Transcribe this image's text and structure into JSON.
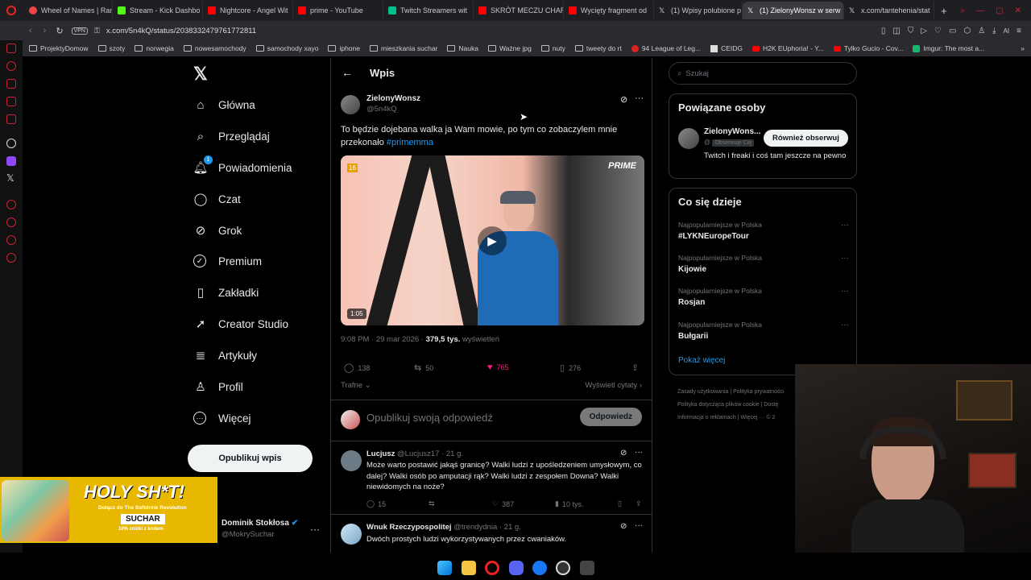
{
  "browser": {
    "tabs": [
      {
        "label": "Wheel of Names | Ran",
        "color": "#e44"
      },
      {
        "label": "Stream - Kick Dashbo",
        "color": "#53fc18"
      },
      {
        "label": "Nightcore - Angel Wit",
        "color": "#ff0000"
      },
      {
        "label": "prime - YouTube",
        "color": "#ff0000"
      },
      {
        "label": "Twitch Streamers wit",
        "color": "#00c08b"
      },
      {
        "label": "SKRÓT MECZU CHAR",
        "color": "#ff0000"
      },
      {
        "label": "Wycięty fragment od",
        "color": "#ff0000"
      },
      {
        "label": "(1) Wpisy polubione p",
        "color": "#dddddd"
      },
      {
        "label": "(1) ZielonyWonsz w serw",
        "color": "#dddddd",
        "active": true
      },
      {
        "label": "x.com/tantehenia/stat",
        "color": "#dddddd"
      }
    ],
    "vpn_label": "VPN",
    "url": "x.com/5n4kQ/status/2038332479761772811",
    "ai_label": "AI",
    "bookmarks": [
      {
        "label": "ProjektyDomow",
        "type": "folder"
      },
      {
        "label": "szoty",
        "type": "folder"
      },
      {
        "label": "norwegia",
        "type": "folder"
      },
      {
        "label": "nowesamochody",
        "type": "folder"
      },
      {
        "label": "samochody xayo",
        "type": "folder"
      },
      {
        "label": "iphone",
        "type": "folder"
      },
      {
        "label": "mieszkania suchar",
        "type": "folder"
      },
      {
        "label": "Nauka",
        "type": "folder"
      },
      {
        "label": "Ważne jpg",
        "type": "folder"
      },
      {
        "label": "nuty",
        "type": "folder"
      },
      {
        "label": "tweety do rt",
        "type": "folder"
      },
      {
        "label": "94 League of Leg...",
        "type": "site"
      },
      {
        "label": "CEIDG",
        "type": "site"
      },
      {
        "label": "H2K EUphoria! - Y...",
        "type": "site"
      },
      {
        "label": "Tylko Gucio - Cov...",
        "type": "site"
      },
      {
        "label": "Imgur: The most a...",
        "type": "site"
      }
    ]
  },
  "nav": {
    "items": [
      {
        "label": "Główna",
        "icon": "home-icon",
        "glyph": "⌂"
      },
      {
        "label": "Przeglądaj",
        "icon": "search-icon",
        "glyph": "⌕"
      },
      {
        "label": "Powiadomienia",
        "icon": "bell-icon",
        "glyph": "♫",
        "badge": "1"
      },
      {
        "label": "Czat",
        "icon": "chat-icon",
        "glyph": "◯"
      },
      {
        "label": "Grok",
        "icon": "grok-icon",
        "glyph": "⊘"
      },
      {
        "label": "Premium",
        "icon": "verified-icon",
        "glyph": "✓"
      },
      {
        "label": "Zakładki",
        "icon": "bookmark-icon",
        "glyph": "▯"
      },
      {
        "label": "Creator Studio",
        "icon": "rocket-icon",
        "glyph": "➚"
      },
      {
        "label": "Artykuły",
        "icon": "article-icon",
        "glyph": "≣"
      },
      {
        "label": "Profil",
        "icon": "profile-icon",
        "glyph": "♙"
      },
      {
        "label": "Więcej",
        "icon": "more-icon",
        "glyph": "⋯"
      }
    ],
    "post_button": "Opublikuj wpis",
    "account": {
      "name": "Dominik Stokłosa",
      "handle": "@MokrySuchar"
    }
  },
  "ad": {
    "headline": "HOLY SH*T!",
    "line1": "Dołącz do The Softdrink Revolution",
    "code": "SUCHAR",
    "line2": "10% zniżki z kodem"
  },
  "main": {
    "header_title": "Wpis",
    "tweet": {
      "name": "ZielonyWonsz",
      "handle": "@5n4kQ",
      "text": "To będzie dojebana walka ja Wam mowie, po tym co zobaczylem mnie przekonało",
      "hashtag": "#primemma",
      "video_duration": "1:05",
      "video_rating": "16",
      "video_brand": "PRIME",
      "time": "9:08 PM · 29 mar 2026 ·",
      "views_count": "379,5 tys.",
      "views_label": "wyświetleń",
      "replies": "138",
      "retweets": "50",
      "likes": "765",
      "bookmarks": "276",
      "sort_label": "Trafne",
      "quotes_label": "Wyświetl cytaty"
    },
    "reply_box": {
      "placeholder": "Opublikuj swoją odpowiedź",
      "button": "Odpowiedz"
    },
    "replies": [
      {
        "name": "Lucjusz",
        "handle": "@Lucjusz17 · 21 g.",
        "text": "Może warto postawić jakąś granicę? Walki ludzi z upośledzeniem umysłowym, co dalej? Walki osób po amputacji rąk? Walki ludzi z zespołem Downa? Walki niewidomych na noże?",
        "replies": "15",
        "likes": "387",
        "views": "10 tys."
      },
      {
        "name": "Wnuk Rzeczypospolitej",
        "handle": "@trendydnia · 21 g.",
        "text": "Dwóch prostych ludzi wykorzystywanych przez cwaniaków."
      }
    ]
  },
  "right": {
    "search_placeholder": "Szukaj",
    "related": {
      "title": "Powiązane osoby",
      "name": "ZielonyWons...",
      "handle": "@",
      "follows_you": "Obserwuje Cię",
      "button": "Również obserwuj",
      "bio": "Twitch i freaki i coś tam jeszcze na pewno"
    },
    "trends": {
      "title": "Co się dzieje",
      "items": [
        {
          "sub": "Najpopularniejsze w Polska",
          "name": "#LYKNEuropeTour"
        },
        {
          "sub": "Najpopularniejsze w Polska",
          "name": "Kijowie"
        },
        {
          "sub": "Najpopularniejsze w Polska",
          "name": "Rosjan"
        },
        {
          "sub": "Najpopularniejsze w Polska",
          "name": "Bułgarii"
        }
      ],
      "show_more": "Pokaż więcej"
    },
    "footer": [
      "Zasady użytkowania",
      "Polityka prywatności",
      "Polityka dotycząca plików cookie",
      "Dostę",
      "Informacja o reklamach",
      "Więcej ···",
      "© 2"
    ]
  }
}
